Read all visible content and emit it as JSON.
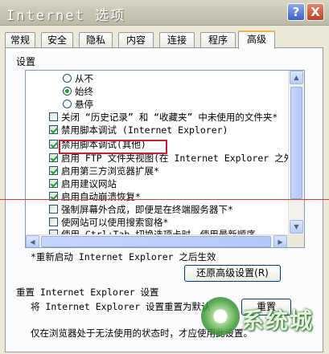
{
  "window": {
    "title": "Internet 选项"
  },
  "title_buttons": {
    "help": "?",
    "close": "X"
  },
  "tabs": [
    "常规",
    "安全",
    "隐私",
    "内容",
    "连接",
    "程序",
    "高级"
  ],
  "active_tab": "高级",
  "settings_group_label": "设置",
  "settings_list": {
    "radios": [
      {
        "label": "从不",
        "selected": false
      },
      {
        "label": "始终",
        "selected": true
      },
      {
        "label": "悬停",
        "selected": false
      }
    ],
    "checkboxes": [
      {
        "label": "关闭 “历史记录” 和 “收藏夹” 中未使用的文件夹*",
        "checked": false
      },
      {
        "label": "禁用脚本调试 (Internet Explorer)",
        "checked": true
      },
      {
        "label": "禁用脚本调试(其他)",
        "checked": true
      },
      {
        "label": "启用 FTP 文件夹视图(在 Internet Explorer 之外)",
        "checked": true
      },
      {
        "label": "启用第三方浏览器扩展*",
        "checked": true
      },
      {
        "label": "启用建议网站",
        "checked": true
      },
      {
        "label": "启用自动崩溃恢复*",
        "checked": true
      },
      {
        "label": "强制屏幕外合成，即便是在终端服务器下*",
        "checked": false
      },
      {
        "label": "使网站可以使用搜索窗格*",
        "checked": false
      },
      {
        "label": "使用 Ctrl+Tab 切换选项卡时，使用最新顺序",
        "checked": false
      }
    ]
  },
  "restart_note": "*重新启动 Internet Explorer 之后生效",
  "restore_button": "还原高级设置(R)",
  "reset_section": {
    "title": "重置 Internet Explorer 设置",
    "description": "将 Internet Explorer 设置重置为默认",
    "button": "重置",
    "warning": "仅在浏览器处于无法使用的状态时，才应使用此设置。"
  },
  "watermark": {
    "text": "系统城"
  },
  "colors": {
    "highlight_box": "#c8202c",
    "annotation_line": "#e03a3a",
    "checkmark": "#21a121"
  }
}
